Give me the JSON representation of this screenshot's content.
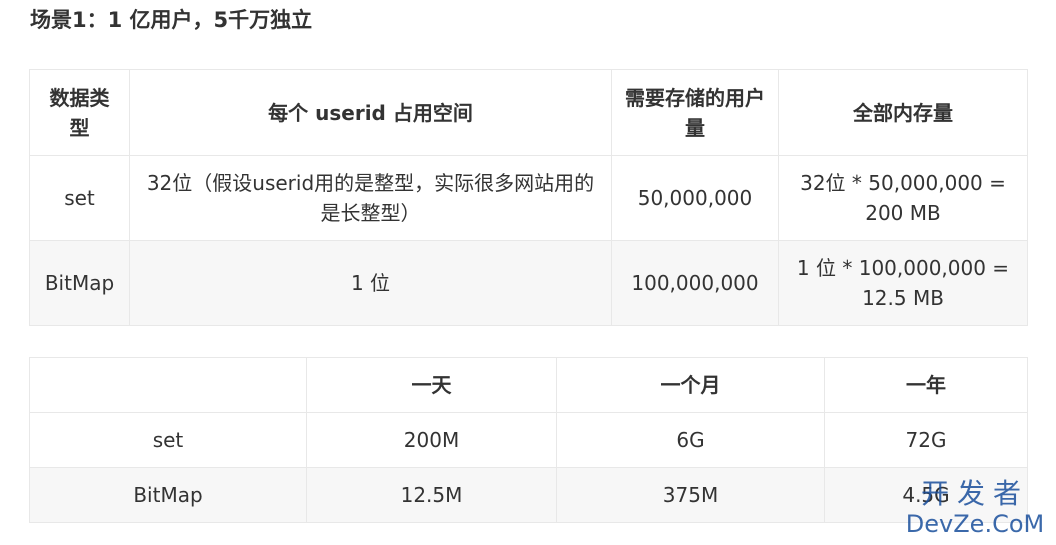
{
  "heading": "场景1：1 亿用户，5千万独立",
  "table1": {
    "headers": [
      "数据类型",
      "每个 userid 占用空间",
      "需要存储的用户量",
      "全部内存量"
    ],
    "rows": [
      [
        "set",
        "32位（假设userid用的是整型，实际很多网站用的是长整型）",
        "50,000,000",
        "32位 * 50,000,000 = 200 MB"
      ],
      [
        "BitMap",
        "1 位",
        "100,000,000",
        "1 位 * 100,000,000 = 12.5 MB"
      ]
    ]
  },
  "table2": {
    "headers": [
      "",
      "一天",
      "一个月",
      "一年"
    ],
    "rows": [
      [
        "set",
        "200M",
        "6G",
        "72G"
      ],
      [
        "BitMap",
        "12.5M",
        "375M",
        "4.5G"
      ]
    ]
  },
  "watermark": {
    "line1": "开发者",
    "line2": "DevZe.CoM",
    "color": "#1a4f9c"
  }
}
